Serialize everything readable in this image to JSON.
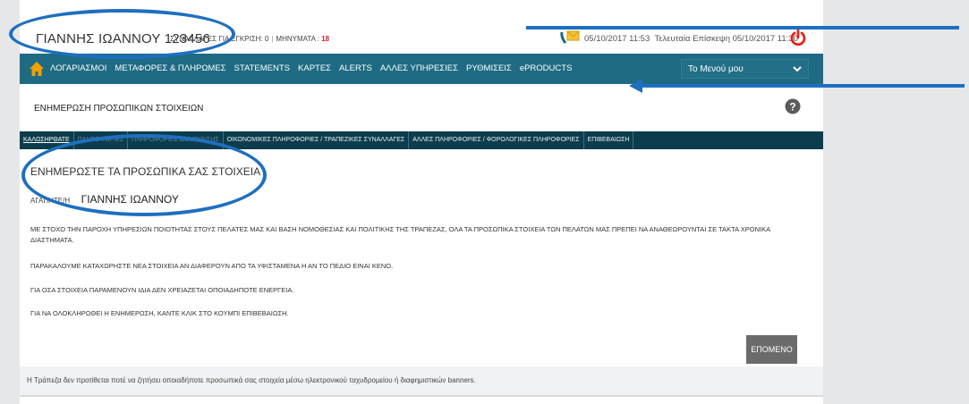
{
  "header": {
    "user_name": "ΓΙΑΝΝΗΣ ΙΩΑΝΝΟΥ 123456",
    "transactions_label": "ΣΥΝΑΛΛΑΓΕΣ ΓΙΑ ΕΓΚΡΙΣΗ: 0",
    "messages_label": "ΜΗΝΥΜΑΤΑ :",
    "messages_count": "18",
    "datetime": "05/10/2017 11:53",
    "last_visit": "Τελευταία Επίσκεψη 05/10/2017 11:30"
  },
  "nav": {
    "items": [
      "ΛΟΓΑΡΙΑΣΜΟΙ",
      "ΜΕΤΑΦΟΡΕΣ & ΠΛΗΡΩΜΕΣ",
      "STATEMENTS",
      "ΚΑΡΤΕΣ",
      "ALERTS",
      "ΑΛΛΕΣ ΥΠΗΡΕΣΙΕΣ",
      "ΡΥΘΜΙΣΕΙΣ",
      "ePRODUCTS"
    ],
    "menu_select": "Το Μενού μου"
  },
  "page": {
    "title": "ΕΝΗΜΕΡΩΣΗ ΠΡΟΣΩΠΙΚΩΝ ΣΤΟΙΧΕΙΩΝ"
  },
  "tabs": [
    "ΚΑΛΩΣΗΡΘΑΤΕ",
    "ΠΛΗΡΟΦΟΡΙΕΣ",
    "ΠΛΗΡΟΦΟΡΙΕΣ ΔΙΕΥΘΥΝΣΗΣ",
    "ΟΙΚΟΝΟΜΙΚΕΣ ΠΛΗΡΟΦΟΡΙΕΣ / ΤΡΑΠΕΖΙΚΕΣ ΣΥΝΑΛΛΑΓΕΣ",
    "ΑΛΛΕΣ ΠΛΗΡΟΦΟΡΙΕΣ / ΦΟΡΟΛΟΓΙΚΕΣ ΠΛΗΡΟΦΟΡΙΕΣ",
    "ΕΠΙΒΕΒΑΙΩΣΗ"
  ],
  "content": {
    "heading": "ΕΝΗΜΕΡΩΣΤΕ ΤΑ ΠΡΟΣΩΠΙΚΑ ΣΑΣ ΣΤΟΙΧΕΙΑ",
    "greeting_label": "ΑΓΑΠΗΤΕ/Η",
    "greeting_name": "ΓΙΑΝΝΗΣ ΙΩΑΝΝΟΥ",
    "paragraphs": [
      "ΜΕ ΣΤΟΧΟ ΤΗΝ ΠΑΡΟΧΗ ΥΠΗΡΕΣΙΩΝ ΠΟΙΟΤΗΤΑΣ ΣΤΟΥΣ ΠΕΛΑΤΕΣ ΜΑΣ ΚΑΙ ΒΑΣΗ ΝΟΜΟΘΕΣΙΑΣ ΚΑΙ ΠΟΛΙΤΙΚΗΣ ΤΗΣ ΤΡΑΠΕΖΑΣ, ΟΛΑ ΤΑ ΠΡΟΣΩΠΙΚΑ ΣΤΟΙΧΕΙΑ ΤΩΝ ΠΕΛΑΤΩΝ ΜΑΣ ΠΡΕΠΕΙ ΝΑ ΑΝΑΘΕΩΡΟΥΝΤΑΙ ΣΕ ΤΑΚΤΑ ΧΡΟΝΙΚΑ ΔΙΑΣΤΗΜΑΤΑ.",
      "ΠΑΡΑΚΑΛΟΥΜΕ ΚΑΤΑΧΩΡΗΣΤΕ ΝΕΑ ΣΤΟΙΧΕΙΑ ΑΝ ΔΙΑΦΕΡΟΥΝ ΑΠΟ ΤΑ ΥΦΙΣΤΑΜΕΝΑ Η ΑΝ ΤΟ ΠΕΔΙΟ ΕΙΝΑΙ ΚΕΝΟ.",
      "ΓΙΑ ΟΣΑ ΣΤΟΙΧΕΙΑ ΠΑΡΑΜΕΝΟΥΝ ΙΔΙΑ ΔΕΝ ΧΡΕΙΑΖΕΤΑΙ ΟΠΟΙΑΔΗΠΟΤΕ ΕΝΕΡΓΕΙΑ.",
      "ΓΙΑ ΝΑ ΟΛΟΚΛΗΡΩΘΕΙ Η ΕΝΗΜΕΡΩΣΗ, ΚΑΝΤΕ ΚΛΙΚ ΣΤΟ ΚΟΥΜΠΙ ΕΠΙΒΕΒΑΙΩΣΗ."
    ],
    "next_button": "ΕΠΟΜΕΝΟ"
  },
  "footer": {
    "text": "Η Τράπεζα δεν προτίθεται ποτέ να ζητήσει οποιαδήποτε προσωπικά σας στοιχεία μέσω ηλεκτρονικού ταχυδρομείου ή διαφημιστικών banners."
  },
  "colors": {
    "nav_bg": "#1e6b83",
    "tabs_bg": "#0d3d4d",
    "annotation": "#1e6fc0",
    "alert_red": "#d4202a",
    "home_icon": "#f2a100"
  }
}
